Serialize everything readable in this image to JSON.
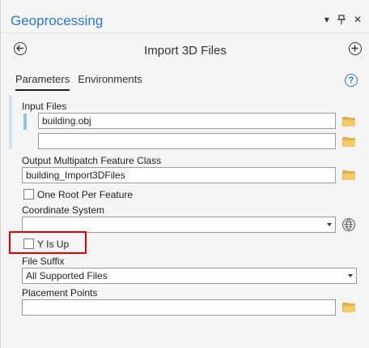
{
  "pane": {
    "title": "Geoprocessing",
    "window_controls": {
      "menu": "▾",
      "pin": "📌",
      "close": "✕"
    }
  },
  "tool": {
    "title": "Import 3D Files",
    "back_icon": "back-arrow-icon",
    "add_icon": "add-icon"
  },
  "tabs": [
    {
      "label": "Parameters",
      "active": true
    },
    {
      "label": "Environments",
      "active": false
    }
  ],
  "help_icon": "?",
  "params": {
    "input_files": {
      "label": "Input Files",
      "values": [
        "building.obj",
        ""
      ]
    },
    "output": {
      "label": "Output Multipatch Feature Class",
      "value": "building_Import3DFiles"
    },
    "one_root": {
      "label": "One Root Per Feature",
      "checked": false
    },
    "coord_system": {
      "label": "Coordinate System",
      "value": ""
    },
    "y_is_up": {
      "label": "Y Is Up",
      "checked": false,
      "highlighted": true
    },
    "file_suffix": {
      "label": "File Suffix",
      "value": "All Supported Files"
    },
    "placement_points": {
      "label": "Placement Points",
      "value": ""
    }
  },
  "colors": {
    "accent": "#2a79c9",
    "highlight_border": "#e00000",
    "folder": "#e2b34b"
  }
}
